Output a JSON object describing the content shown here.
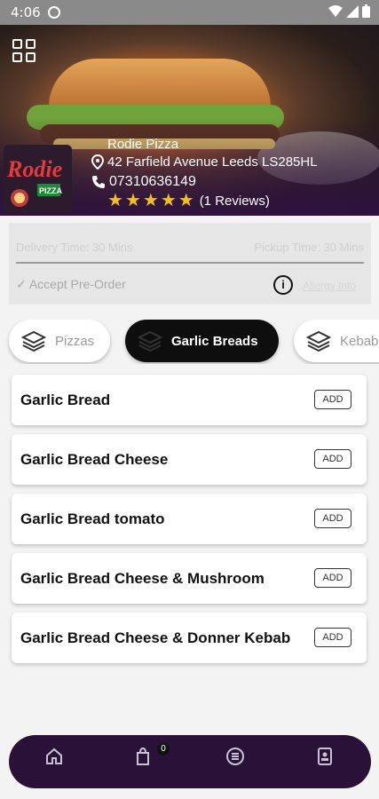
{
  "status_bar": {
    "time": "4:06"
  },
  "restaurant": {
    "name": "Rodie Pizza",
    "address": "42 Farfield Avenue Leeds LS285HL",
    "phone": "07310636149",
    "rating": 5,
    "reviews": "(1 Reviews)",
    "logo_text": "Rodie",
    "logo_subtext": "PIZZA"
  },
  "info": {
    "delivery_time": "Delivery Time: 30 Mins",
    "pickup_time": "Pickup Time: 30 Mins",
    "preorder": "✓ Accept Pre-Order",
    "allergy": "Allergy Info"
  },
  "tabs": [
    {
      "label": "Pizzas",
      "active": false
    },
    {
      "label": "Garlic Breads",
      "active": true
    },
    {
      "label": "Kebabs",
      "active": false
    }
  ],
  "menu_items": [
    {
      "name": "Garlic Bread",
      "action": "ADD"
    },
    {
      "name": "Garlic Bread Cheese",
      "action": "ADD"
    },
    {
      "name": "Garlic Bread tomato",
      "action": "ADD"
    },
    {
      "name": "Garlic Bread Cheese & Mushroom",
      "action": "ADD"
    },
    {
      "name": "Garlic Bread Cheese & Donner Kebab",
      "action": "ADD"
    }
  ],
  "bottom_nav": {
    "cart_count": "0",
    "icons": [
      "home-icon",
      "cart-icon",
      "menu-icon",
      "profile-icon"
    ]
  },
  "colors": {
    "nav_bg": "#2a1137",
    "star": "#f4c10f",
    "active_tab": "#0e0e0e"
  }
}
